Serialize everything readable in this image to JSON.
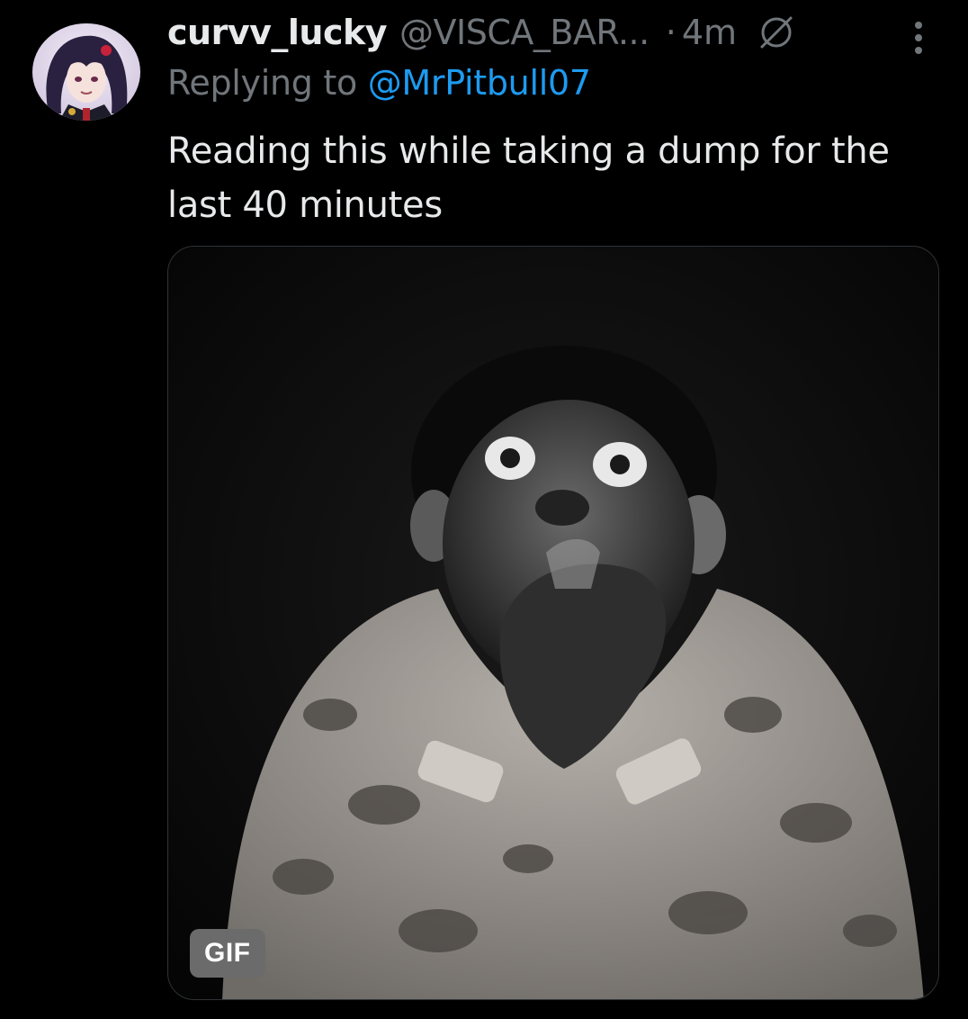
{
  "tweet": {
    "display_name": "curvv_lucky",
    "handle": "@VISCA_BAR...",
    "separator": "·",
    "time": "4m",
    "replying_prefix": "Replying to",
    "replying_to": "@MrPitbull07",
    "text": "Reading this while taking a dump for the last 40 minutes",
    "media": {
      "type": "gif",
      "badge_label": "GIF"
    },
    "icons": {
      "avatar": "anime-avatar",
      "verified_or_grok": "slashed-circle-icon",
      "more": "more-vertical-icon"
    }
  },
  "colors": {
    "background": "#000000",
    "text_primary": "#e7e9ea",
    "text_secondary": "#71767b",
    "link": "#1d9bf0"
  }
}
